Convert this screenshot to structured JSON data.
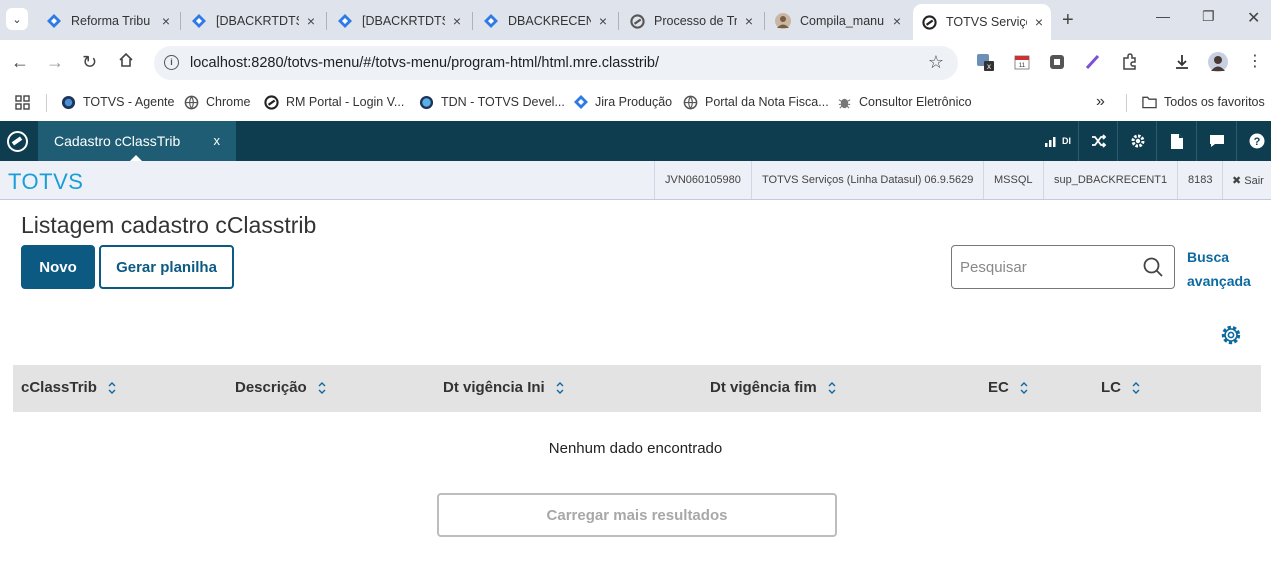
{
  "browser": {
    "tabs": [
      {
        "label": "Reforma Tribu",
        "icon": "diamond-blue-icon",
        "active": false
      },
      {
        "label": "[DBACKRTDTS",
        "icon": "diamond-blue-icon",
        "active": false
      },
      {
        "label": "[DBACKRTDTS",
        "icon": "diamond-blue-icon",
        "active": false
      },
      {
        "label": "DBACKRECEN",
        "icon": "diamond-blue-icon",
        "active": false
      },
      {
        "label": "Processo de Tr",
        "icon": "totvs-gray-icon",
        "active": false
      },
      {
        "label": "Compila_manu",
        "icon": "avatar-icon",
        "active": false
      },
      {
        "label": "TOTVS Serviço",
        "icon": "totvs-dark-icon",
        "active": true
      }
    ],
    "close_glyph": "×",
    "new_tab_glyph": "+",
    "url": "localhost:8280/totvs-menu/#/totvs-menu/program-html/html.mre.classtrib/",
    "bookmarks": [
      {
        "label": "TOTVS - Agente",
        "icon": "globe-dark-icon"
      },
      {
        "label": "Chrome",
        "icon": "globe-gray-icon"
      },
      {
        "label": "RM Portal - Login V...",
        "icon": "totvs-dark-icon"
      },
      {
        "label": "TDN - TOTVS Devel...",
        "icon": "globe-blue-icon"
      },
      {
        "label": "Jira Produção",
        "icon": "jira-icon"
      },
      {
        "label": "Portal da Nota Fisca...",
        "icon": "globe-gray-icon"
      },
      {
        "label": "Consultor Eletrônico",
        "icon": "bug-icon"
      }
    ],
    "more_glyph": "»",
    "all_bookmarks": "Todos os favoritos"
  },
  "app": {
    "tab_label": "Cadastro cClassTrib",
    "tab_close": "x",
    "dl_label": "DI",
    "brand": "TOTVS",
    "info": [
      "JVN060105980",
      "TOTVS Serviços (Linha Datasul) 06.9.5629",
      "MSSQL",
      "sup_DBACKRECENT1",
      "8183"
    ],
    "logout": "✖ Sair"
  },
  "page": {
    "title": "Listagem cadastro cClasstrib",
    "new_button": "Novo",
    "sheet_button": "Gerar planilha",
    "search_placeholder": "Pesquisar",
    "advanced_search_line1": "Busca",
    "advanced_search_line2": "avançada",
    "columns": [
      "cClassTrib",
      "Descrição",
      "Dt vigência Ini",
      "Dt vigência fim",
      "EC",
      "LC"
    ],
    "empty_message": "Nenhum dado encontrado",
    "load_more": "Carregar mais resultados"
  },
  "colors": {
    "appbar": "#0d3d4f",
    "app_tab": "#1e5d73",
    "brand": "#1a9ed6",
    "primary": "#0c5a82"
  }
}
